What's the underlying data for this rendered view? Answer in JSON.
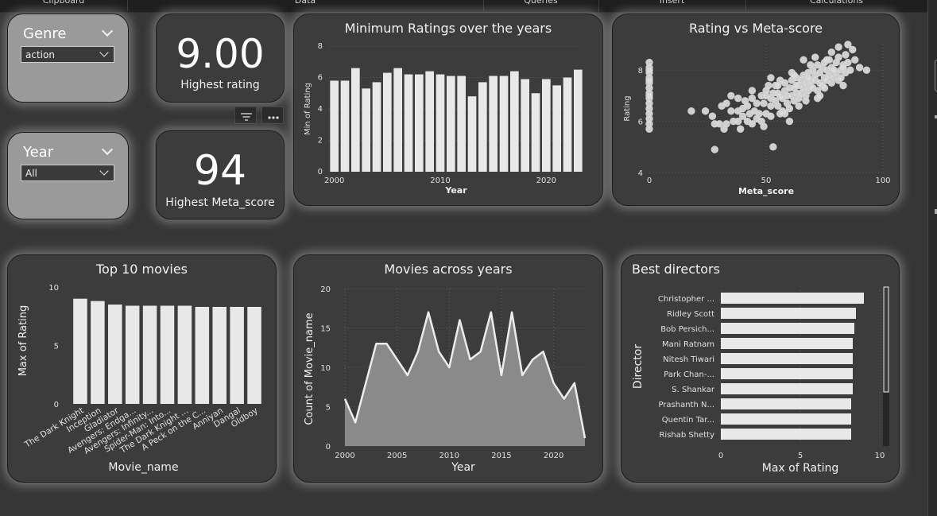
{
  "ribbon": {
    "groups": [
      "Clipboard",
      "Data",
      "Queries",
      "Insert",
      "Calculations"
    ]
  },
  "slicers": {
    "genre": {
      "title": "Genre",
      "value": "action"
    },
    "year": {
      "title": "Year",
      "value": "All"
    }
  },
  "kpis": {
    "rating": {
      "value": "9.00",
      "label": "Highest rating"
    },
    "meta": {
      "value": "94",
      "label": "Highest Meta_score"
    }
  },
  "colors": {
    "bar": "#e8e8e8",
    "area": "#8a8a8a",
    "line": "#ececec",
    "card": "#3c3c3c",
    "slicer": "#9a9a9a"
  },
  "icons": {
    "filter": "filter-icon",
    "more": "more-options-icon"
  },
  "chart_data": [
    {
      "id": "min_ratings",
      "type": "bar",
      "title": "Minimum Ratings over the years",
      "xlabel": "Year",
      "ylabel": "Min of Rating",
      "x": [
        2000,
        2001,
        2002,
        2003,
        2004,
        2005,
        2006,
        2007,
        2008,
        2009,
        2010,
        2011,
        2012,
        2013,
        2014,
        2015,
        2016,
        2017,
        2018,
        2019,
        2020,
        2021,
        2022,
        2023
      ],
      "values": [
        5.8,
        5.8,
        6.6,
        5.3,
        5.7,
        6.3,
        6.6,
        6.2,
        6.2,
        6.4,
        6.2,
        6.1,
        6.1,
        4.8,
        5.7,
        6.1,
        6.1,
        6.4,
        5.9,
        5.0,
        5.9,
        5.5,
        6.0,
        6.5
      ],
      "ylim": [
        0,
        8
      ],
      "yticks": [
        "0",
        "2",
        "4",
        "6",
        "8"
      ],
      "xticks": [
        "2000",
        "2010",
        "2020"
      ]
    },
    {
      "id": "scatter",
      "type": "scatter",
      "title": "Rating vs Meta-score",
      "xlabel": "Meta_score",
      "ylabel": "Rating",
      "xlim": [
        0,
        100
      ],
      "ylim": [
        4,
        9
      ],
      "xticks": [
        "0",
        "50",
        "100"
      ],
      "yticks": [
        "4",
        "6",
        "8"
      ],
      "points": [
        [
          0,
          8.3
        ],
        [
          0,
          8.1
        ],
        [
          0,
          7.9
        ],
        [
          0,
          7.7
        ],
        [
          0,
          7.5
        ],
        [
          0,
          7.3
        ],
        [
          0,
          7.1
        ],
        [
          0,
          6.9
        ],
        [
          0,
          6.7
        ],
        [
          0,
          6.5
        ],
        [
          0,
          6.3
        ],
        [
          0,
          6.1
        ],
        [
          0,
          5.9
        ],
        [
          0,
          5.7
        ],
        [
          0,
          7.0
        ],
        [
          0,
          7.6
        ],
        [
          0,
          8.0
        ],
        [
          18,
          6.4
        ],
        [
          24,
          6.4
        ],
        [
          27,
          6.2
        ],
        [
          28,
          5.9
        ],
        [
          30,
          5.9
        ],
        [
          31,
          6.6
        ],
        [
          33,
          5.9
        ],
        [
          33,
          6.7
        ],
        [
          35,
          6.4
        ],
        [
          35,
          7.0
        ],
        [
          36,
          6.0
        ],
        [
          38,
          6.4
        ],
        [
          38,
          6.9
        ],
        [
          39,
          5.7
        ],
        [
          40,
          6.5
        ],
        [
          40,
          6.2
        ],
        [
          41,
          6.8
        ],
        [
          42,
          6.0
        ],
        [
          42,
          6.6
        ],
        [
          43,
          6.3
        ],
        [
          44,
          5.9
        ],
        [
          44,
          7.2
        ],
        [
          45,
          6.4
        ],
        [
          46,
          6.7
        ],
        [
          47,
          6.3
        ],
        [
          48,
          7.0
        ],
        [
          48,
          6.0
        ],
        [
          49,
          6.7
        ],
        [
          50,
          7.0
        ],
        [
          50,
          6.3
        ],
        [
          51,
          7.4
        ],
        [
          52,
          6.6
        ],
        [
          52,
          6.9
        ],
        [
          53,
          7.1
        ],
        [
          53,
          5.0
        ],
        [
          54,
          6.8
        ],
        [
          54,
          7.4
        ],
        [
          55,
          6.6
        ],
        [
          55,
          7.1
        ],
        [
          56,
          7.0
        ],
        [
          56,
          7.6
        ],
        [
          57,
          6.4
        ],
        [
          57,
          6.9
        ],
        [
          58,
          7.2
        ],
        [
          58,
          7.5
        ],
        [
          59,
          6.7
        ],
        [
          59,
          7.0
        ],
        [
          60,
          7.3
        ],
        [
          60,
          6.5
        ],
        [
          61,
          7.0
        ],
        [
          61,
          7.6
        ],
        [
          62,
          7.3
        ],
        [
          62,
          6.8
        ],
        [
          63,
          7.1
        ],
        [
          63,
          7.7
        ],
        [
          64,
          7.4
        ],
        [
          64,
          6.9
        ],
        [
          65,
          7.6
        ],
        [
          65,
          7.1
        ],
        [
          66,
          7.8
        ],
        [
          66,
          7.3
        ],
        [
          67,
          7.0
        ],
        [
          67,
          7.5
        ],
        [
          68,
          7.9
        ],
        [
          68,
          7.2
        ],
        [
          69,
          7.6
        ],
        [
          69,
          7.4
        ],
        [
          70,
          8.0
        ],
        [
          70,
          7.3
        ],
        [
          71,
          7.6
        ],
        [
          71,
          7.8
        ],
        [
          72,
          7.2
        ],
        [
          72,
          8.2
        ],
        [
          73,
          7.5
        ],
        [
          73,
          7.9
        ],
        [
          74,
          8.1
        ],
        [
          74,
          7.4
        ],
        [
          75,
          7.7
        ],
        [
          75,
          8.3
        ],
        [
          76,
          7.6
        ],
        [
          76,
          8.0
        ],
        [
          77,
          8.4
        ],
        [
          77,
          7.8
        ],
        [
          78,
          7.5
        ],
        [
          78,
          8.1
        ],
        [
          79,
          7.7
        ],
        [
          80,
          8.3
        ],
        [
          80,
          7.9
        ],
        [
          81,
          7.6
        ],
        [
          81,
          8.5
        ],
        [
          82,
          8.0
        ],
        [
          82,
          7.7
        ],
        [
          83,
          8.2
        ],
        [
          84,
          8.6
        ],
        [
          84,
          7.9
        ],
        [
          85,
          8.3
        ],
        [
          86,
          8.0
        ],
        [
          88,
          8.4
        ],
        [
          90,
          8.1
        ],
        [
          93,
          8.0
        ],
        [
          67,
          6.8
        ],
        [
          72,
          6.9
        ],
        [
          64,
          6.6
        ],
        [
          58,
          6.3
        ],
        [
          52,
          7.7
        ],
        [
          46,
          6.1
        ],
        [
          61,
          7.9
        ],
        [
          69,
          8.2
        ],
        [
          75,
          7.3
        ],
        [
          83,
          7.4
        ],
        [
          60,
          6.0
        ],
        [
          56,
          6.3
        ],
        [
          49,
          5.8
        ],
        [
          66,
          8.4
        ],
        [
          78,
          8.7
        ],
        [
          87,
          8.8
        ],
        [
          85,
          9.0
        ],
        [
          71,
          8.5
        ],
        [
          62,
          7.8
        ],
        [
          55,
          7.4
        ],
        [
          44,
          6.9
        ],
        [
          38,
          6.0
        ],
        [
          32,
          5.7
        ],
        [
          50,
          7.2
        ],
        [
          52,
          6.2
        ],
        [
          63,
          7.4
        ],
        [
          68,
          7.7
        ],
        [
          73,
          7.0
        ],
        [
          79,
          8.0
        ],
        [
          83,
          8.1
        ],
        [
          76,
          8.4
        ],
        [
          81,
          8.9
        ],
        [
          28,
          4.9
        ]
      ]
    },
    {
      "id": "top10",
      "type": "bar",
      "title": "Top 10 movies",
      "xlabel": "Movie_name",
      "ylabel": "Max of Rating",
      "categories": [
        "The Dark Knight",
        "Inception",
        "Gladiator",
        "Avengers: Endga...",
        "Avengers: Infinity...",
        "Spider-Man: Into...",
        "The Dark Knight ...",
        "A Peck on the C...",
        "Anniyan",
        "Dangal",
        "Oldboy"
      ],
      "values": [
        9.0,
        8.8,
        8.5,
        8.4,
        8.4,
        8.4,
        8.4,
        8.3,
        8.3,
        8.3,
        8.3
      ],
      "ylim": [
        0,
        10
      ],
      "yticks": [
        "0",
        "5",
        "10"
      ]
    },
    {
      "id": "across_years",
      "type": "area",
      "title": "Movies across years",
      "xlabel": "Year",
      "ylabel": "Count of Movie_name",
      "x": [
        2000,
        2001,
        2002,
        2003,
        2004,
        2005,
        2006,
        2007,
        2008,
        2009,
        2010,
        2011,
        2012,
        2013,
        2014,
        2015,
        2016,
        2017,
        2018,
        2019,
        2020,
        2021,
        2022,
        2023
      ],
      "values": [
        6,
        3,
        8,
        13,
        13,
        11,
        9,
        12,
        17,
        12,
        10,
        16,
        11,
        12,
        17,
        9,
        17,
        9,
        11,
        12,
        8,
        6,
        8,
        1
      ],
      "ylim": [
        0,
        20
      ],
      "xlim": [
        2000,
        2023
      ],
      "yticks": [
        "0",
        "5",
        "10",
        "15",
        "20"
      ],
      "xticks": [
        "2000",
        "2005",
        "2010",
        "2015",
        "2020"
      ]
    },
    {
      "id": "directors",
      "type": "bar",
      "orientation": "horizontal",
      "title": "Best directors",
      "xlabel": "Max of Rating",
      "ylabel": "Director",
      "categories": [
        "Christopher ...",
        "Ridley Scott",
        "Bob Persich...",
        "Mani Ratnam",
        "Nitesh Tiwari",
        "Park Chan-...",
        "S. Shankar",
        "Prashanth N...",
        "Quentin Tar...",
        "Rishab Shetty"
      ],
      "values": [
        9.0,
        8.5,
        8.4,
        8.3,
        8.3,
        8.3,
        8.3,
        8.2,
        8.2,
        8.2
      ],
      "xlim": [
        0,
        10
      ],
      "xticks": [
        "0",
        "5",
        "10"
      ]
    }
  ]
}
